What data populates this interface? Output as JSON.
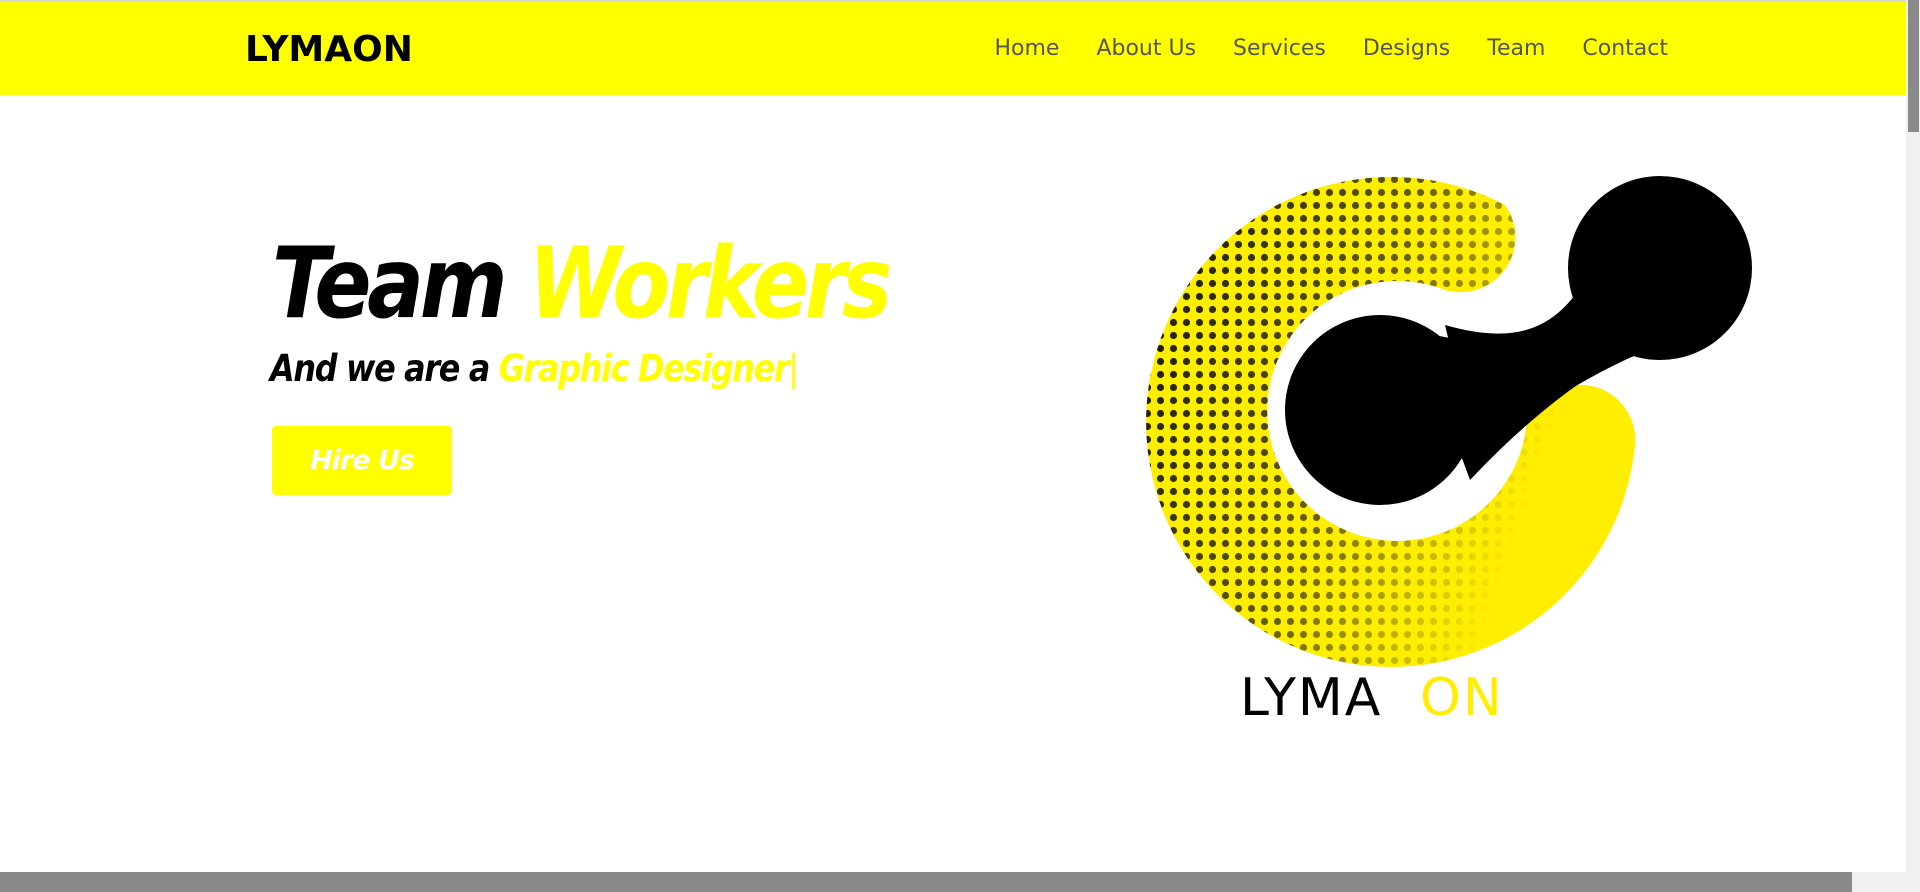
{
  "brand": {
    "name": "LYMAON"
  },
  "nav": {
    "items": [
      {
        "label": "Home"
      },
      {
        "label": "About Us"
      },
      {
        "label": "Services"
      },
      {
        "label": "Designs"
      },
      {
        "label": "Team"
      },
      {
        "label": "Contact"
      }
    ]
  },
  "hero": {
    "title_part1": "Team",
    "title_part2": "Workers",
    "subtitle_part1": "And we are a",
    "subtitle_part2": "Graphic Designer",
    "cursor": "|",
    "cta_label": "Hire Us"
  },
  "logo": {
    "text_part1": "LYMA",
    "text_part2": "ON"
  },
  "colors": {
    "accent": "#ffff00",
    "logo_yellow": "#ffee00",
    "text_dark": "#000000",
    "nav_text": "#555555",
    "button_text": "#ffffff"
  }
}
